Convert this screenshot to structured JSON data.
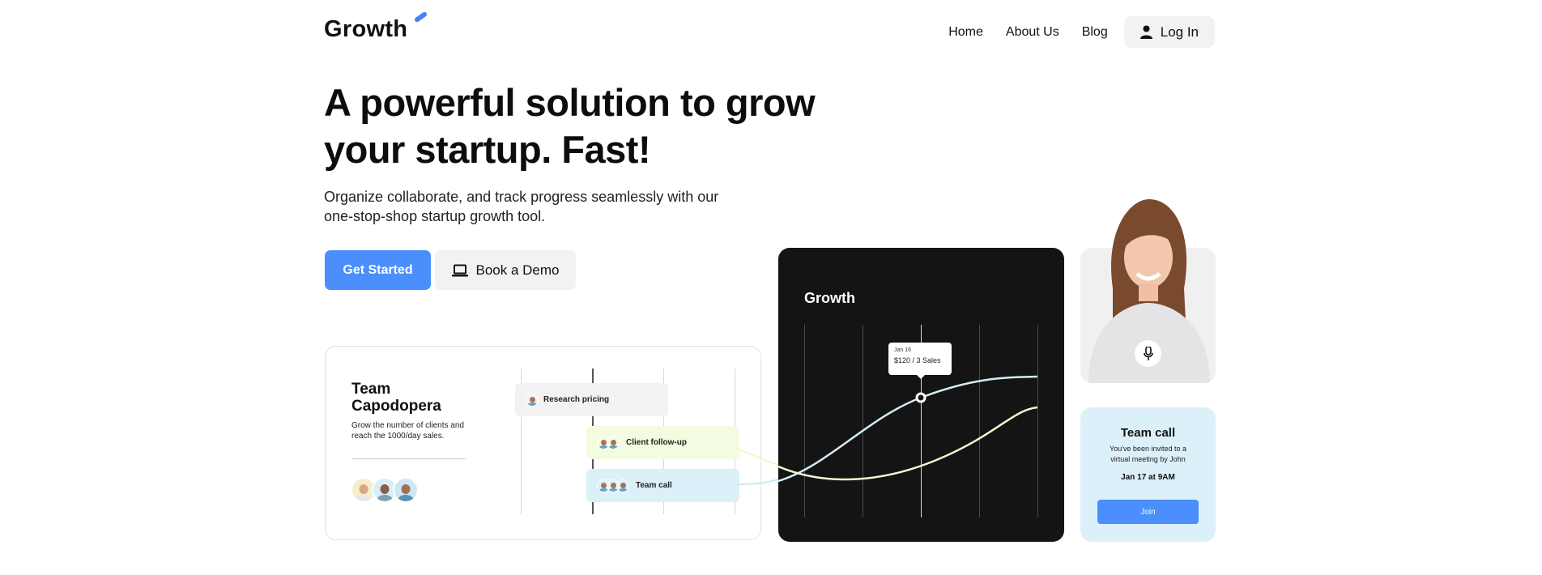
{
  "brand": {
    "name": "Growth",
    "accent": "#3f86f8"
  },
  "nav": {
    "home": "Home",
    "about": "About Us",
    "blog": "Blog",
    "login": "Log In"
  },
  "hero": {
    "title": "A powerful solution to grow your startup. Fast!",
    "subtitle": "Organize collaborate, and track progress seamlessly with our one-stop-shop startup growth tool.",
    "primary_cta": "Get Started",
    "secondary_cta": "Book a Demo"
  },
  "team_card": {
    "title": "Team Capodopera",
    "description": "Grow the number of clients and reach the 1000/day sales.",
    "tasks": [
      {
        "label": "Research pricing",
        "color": "#f2f2f3"
      },
      {
        "label": "Client follow-up",
        "color": "#f3fbe0"
      },
      {
        "label": "Team call",
        "color": "#dcf0fa"
      }
    ]
  },
  "growth_card": {
    "title": "Growth",
    "tooltip_date": "Jan 16",
    "tooltip_value": "$120 / 3 Sales"
  },
  "call_card": {
    "title": "Team call",
    "description": "You've been invited to a virtual meeting by John",
    "time": "Jan 17 at 9AM",
    "join": "Join"
  },
  "icons": {
    "user": "user-icon",
    "laptop": "laptop-icon",
    "mic": "microphone-icon"
  }
}
